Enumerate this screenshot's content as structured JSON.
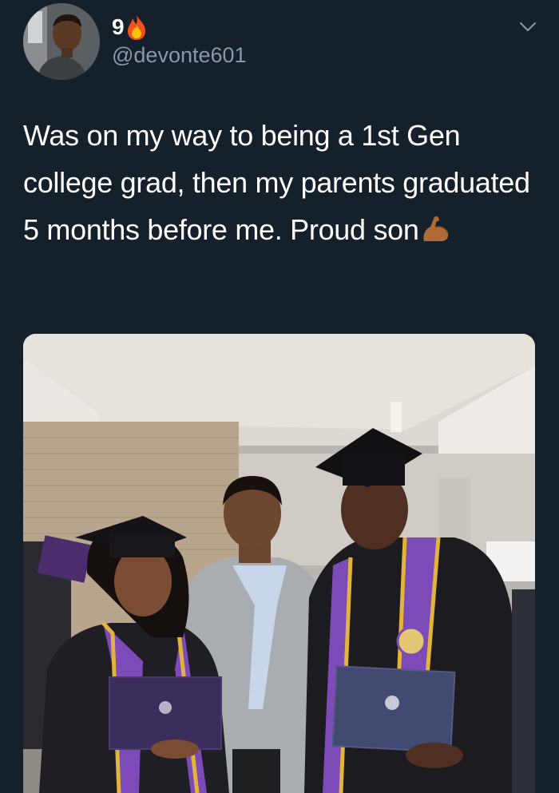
{
  "tweet": {
    "display_name": "9",
    "name_emoji_icon": "fire-icon",
    "handle": "@devonte601",
    "text": "Was on my way to being a 1st Gen college grad, then my parents graduated 5 months before me. Proud son",
    "text_emoji_icon": "flexed-biceps-icon",
    "menu_icon": "chevron-down-icon",
    "media_icon": "graduation-photo"
  },
  "colors": {
    "background": "#15202b",
    "text_primary": "#ffffff",
    "text_secondary": "#8899a6"
  }
}
